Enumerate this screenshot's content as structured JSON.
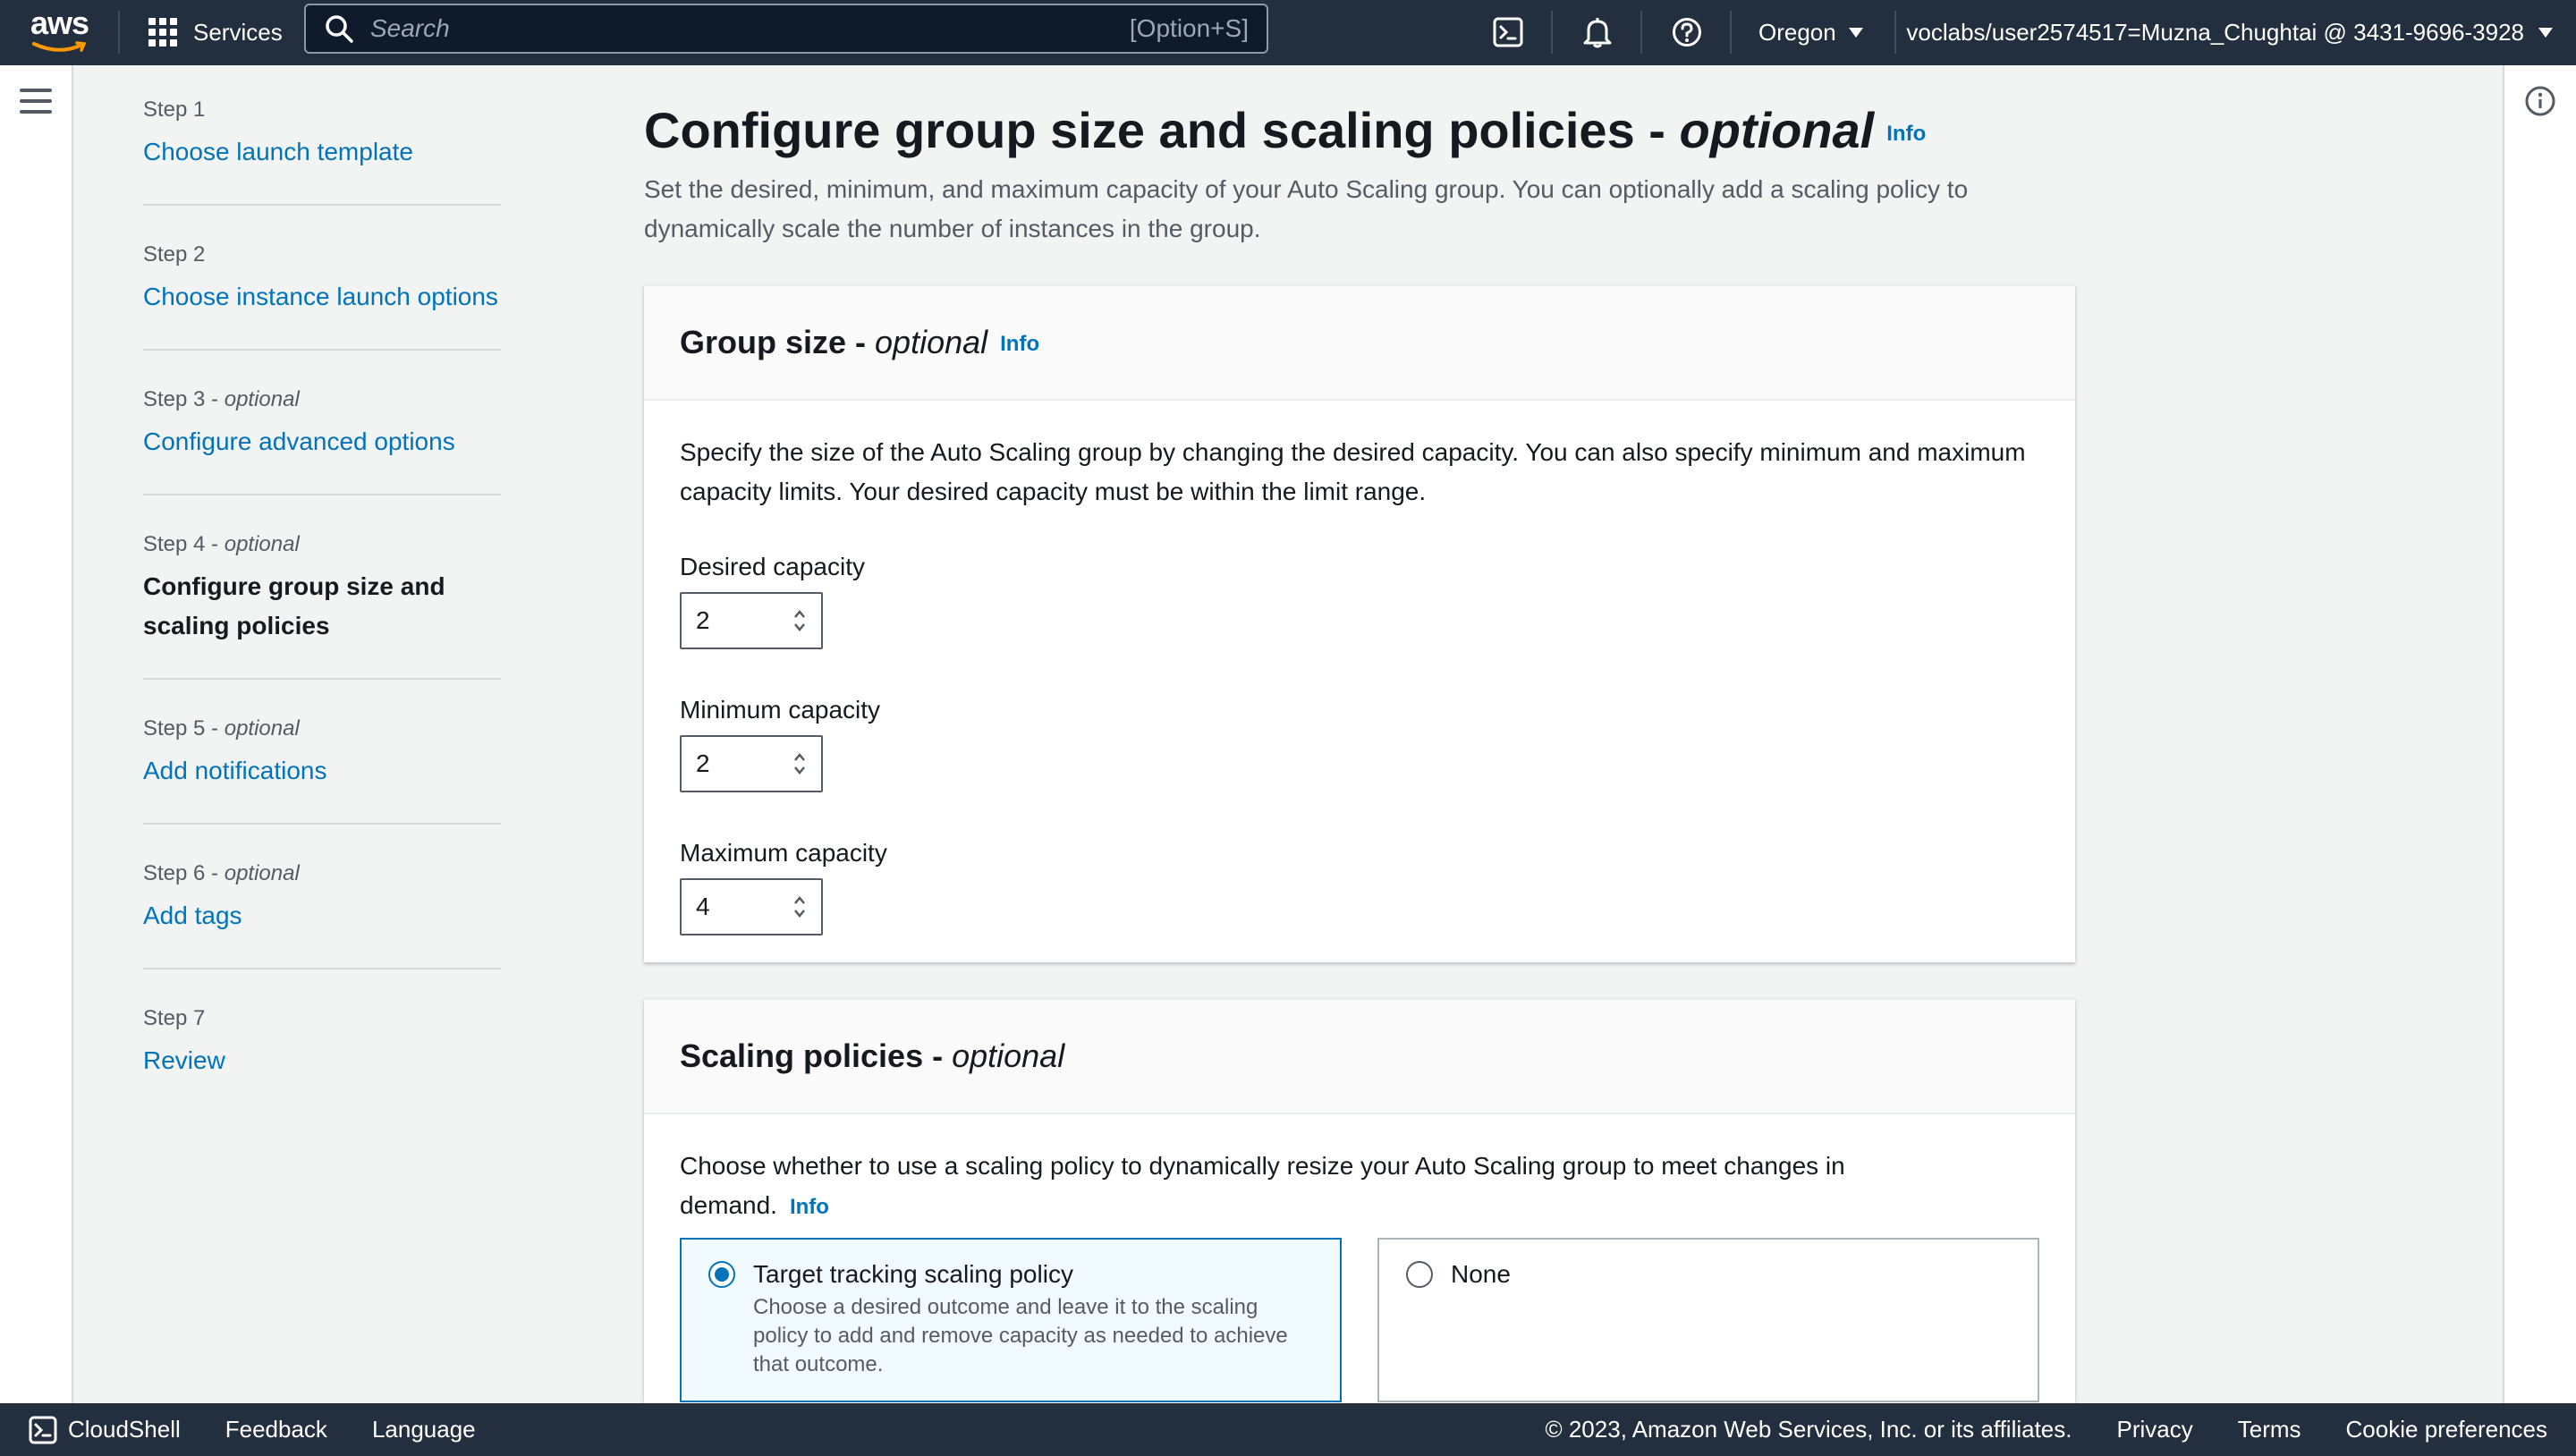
{
  "topnav": {
    "logo_text": "aws",
    "services_label": "Services",
    "search_placeholder": "Search",
    "search_shortcut": "[Option+S]",
    "region": "Oregon",
    "account": "voclabs/user2574517=Muzna_Chughtai @ 3431-9696-3928"
  },
  "steps": [
    {
      "label": "Step 1",
      "optional": "",
      "title": "Choose launch template"
    },
    {
      "label": "Step 2",
      "optional": "",
      "title": "Choose instance launch options"
    },
    {
      "label": "Step 3 - ",
      "optional": "optional",
      "title": "Configure advanced options"
    },
    {
      "label": "Step 4 - ",
      "optional": "optional",
      "title": "Configure group size and scaling policies"
    },
    {
      "label": "Step 5 - ",
      "optional": "optional",
      "title": "Add notifications"
    },
    {
      "label": "Step 6 - ",
      "optional": "optional",
      "title": "Add tags"
    },
    {
      "label": "Step 7",
      "optional": "",
      "title": "Review"
    }
  ],
  "page": {
    "title": "Configure group size and scaling policies - ",
    "title_optional": "optional",
    "info": "Info",
    "description": "Set the desired, minimum, and maximum capacity of your Auto Scaling group. You can optionally add a scaling policy to dynamically scale the number of instances in the group."
  },
  "group_size": {
    "title": "Group size - ",
    "title_optional": "optional",
    "info": "Info",
    "description": "Specify the size of the Auto Scaling group by changing the desired capacity. You can also specify minimum and maximum capacity limits. Your desired capacity must be within the limit range.",
    "desired_label": "Desired capacity",
    "desired_value": "2",
    "min_label": "Minimum capacity",
    "min_value": "2",
    "max_label": "Maximum capacity",
    "max_value": "4"
  },
  "scaling": {
    "title": "Scaling policies - ",
    "title_optional": "optional",
    "description": "Choose whether to use a scaling policy to dynamically resize your Auto Scaling group to meet changes in demand.",
    "info": "Info",
    "options": [
      {
        "title": "Target tracking scaling policy",
        "desc": "Choose a desired outcome and leave it to the scaling policy to add and remove capacity as needed to achieve that outcome.",
        "selected": true
      },
      {
        "title": "None",
        "desc": "",
        "selected": false
      }
    ]
  },
  "footer": {
    "cloudshell": "CloudShell",
    "feedback": "Feedback",
    "language": "Language",
    "copyright": "© 2023, Amazon Web Services, Inc. or its affiliates.",
    "privacy": "Privacy",
    "terms": "Terms",
    "cookies": "Cookie preferences"
  },
  "colors": {
    "nav_bg": "#232f3e",
    "link": "#0073bb",
    "page_bg": "#f2f3f3"
  }
}
